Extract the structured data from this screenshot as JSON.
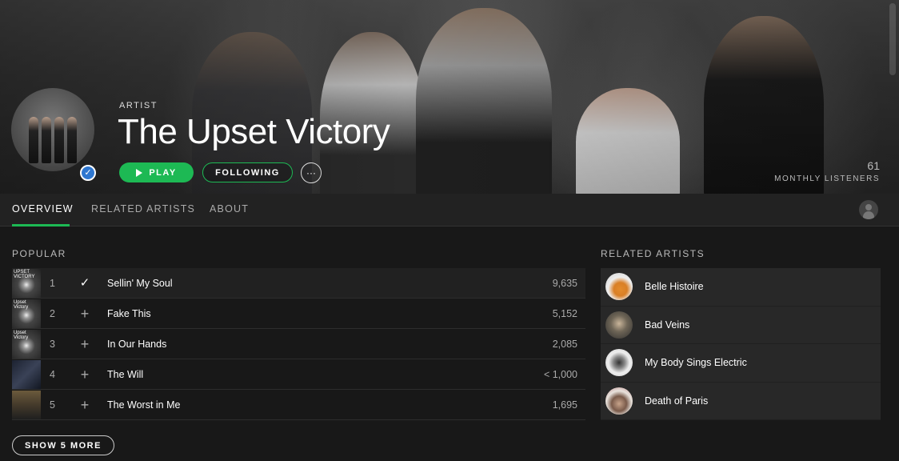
{
  "artist": {
    "label": "ARTIST",
    "name": "The Upset Victory",
    "verified_mark": "✓",
    "play_label": "PLAY",
    "follow_label": "FOLLOWING",
    "more_label": "···",
    "monthly_listeners_count": "61",
    "monthly_listeners_label": "MONTHLY LISTENERS"
  },
  "tabs": [
    {
      "label": "OVERVIEW",
      "active": true
    },
    {
      "label": "RELATED ARTISTS",
      "active": false
    },
    {
      "label": "ABOUT",
      "active": false
    }
  ],
  "popular": {
    "title": "POPULAR",
    "tracks": [
      {
        "num": "1",
        "action": "✓",
        "name": "Sellin' My Soul",
        "plays": "9,635",
        "art_text": "UPSET VICTORY"
      },
      {
        "num": "2",
        "action": "+",
        "name": "Fake This",
        "plays": "5,152",
        "art_text": "Upset Victory"
      },
      {
        "num": "3",
        "action": "+",
        "name": "In Our Hands",
        "plays": "2,085",
        "art_text": "Upset Victory"
      },
      {
        "num": "4",
        "action": "+",
        "name": "The Will",
        "plays": "< 1,000",
        "art_text": ""
      },
      {
        "num": "5",
        "action": "+",
        "name": "The Worst in Me",
        "plays": "1,695",
        "art_text": ""
      }
    ],
    "show_more_label": "SHOW 5 MORE"
  },
  "related": {
    "title": "RELATED ARTISTS",
    "artists": [
      {
        "name": "Belle Histoire"
      },
      {
        "name": "Bad Veins"
      },
      {
        "name": "My Body Sings Electric"
      },
      {
        "name": "Death of Paris"
      }
    ]
  },
  "colors": {
    "accent": "#1db954",
    "background": "#181818",
    "verified": "#2e77d0"
  },
  "icons": {
    "play": "play-icon",
    "check": "check-icon",
    "add": "plus-icon",
    "more": "ellipsis-icon",
    "user": "user-icon"
  }
}
